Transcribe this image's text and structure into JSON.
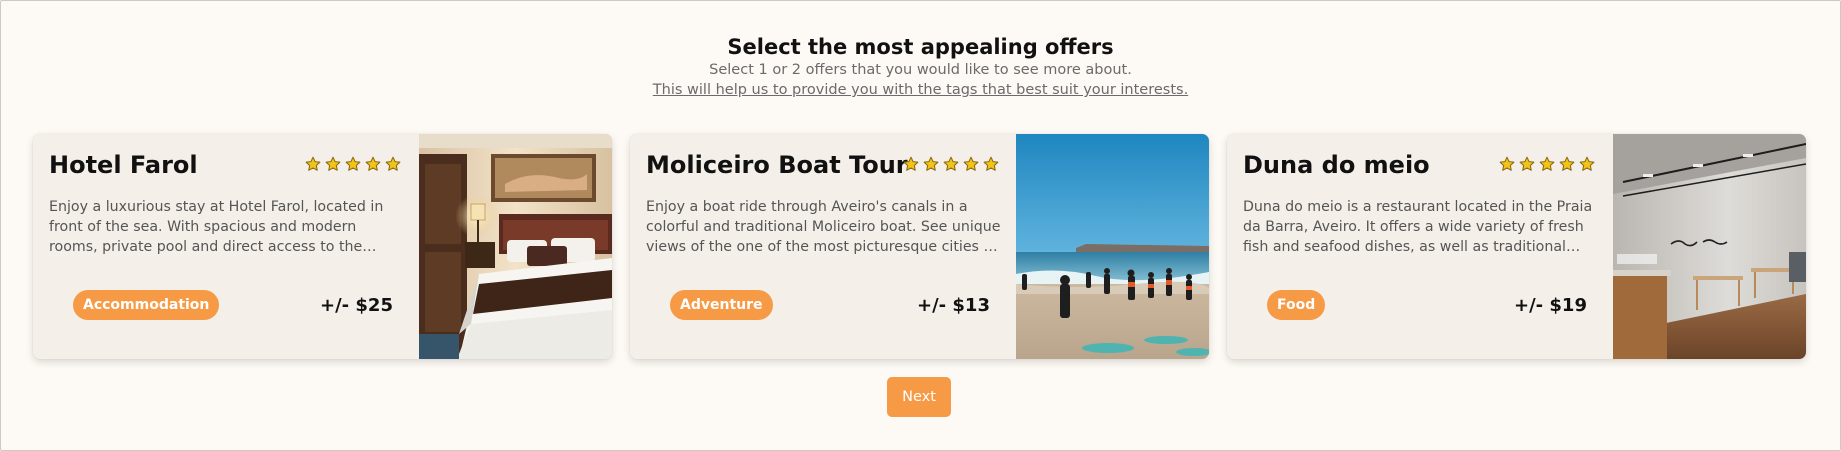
{
  "header": {
    "title": "Select the most appealing offers",
    "subtitle": "Select 1 or 2 offers that you would like to see more about.",
    "info_link": "This will help us to provide you with the tags that best suit your interests."
  },
  "offers": [
    {
      "name": "Hotel Farol",
      "rating": 5,
      "description": "Enjoy a luxurious stay at Hotel Farol, located in front of the sea. With spacious and modern rooms, private pool and direct access to the beach, Hotel Farol is th...",
      "tag": "Accommodation",
      "price": "+/- $25",
      "image": "hotel-bedroom-photo"
    },
    {
      "name": "Moliceiro Boat Tour",
      "rating": 5,
      "description": "Enjoy a boat ride through Aveiro's canals in a colorful and traditional Moliceiro boat. See unique views of the one of the most picturesque cities of Portugal.",
      "tag": "Adventure",
      "price": "+/- $13",
      "image": "beach-surfers-photo"
    },
    {
      "name": "Duna do meio",
      "rating": 5,
      "description": "Duna do meio is a restaurant located in the Praia da Barra, Aveiro. It offers a wide variety of fresh fish and seafood dishes, as well as traditional Portuguese...",
      "tag": "Food",
      "price": "+/- $19",
      "image": "restaurant-interior-photo"
    }
  ],
  "next_label": "Next",
  "colors": {
    "accent": "#f79a45",
    "background": "#fdf9f4",
    "card": "#f4efe9",
    "star": "#f2c318"
  }
}
